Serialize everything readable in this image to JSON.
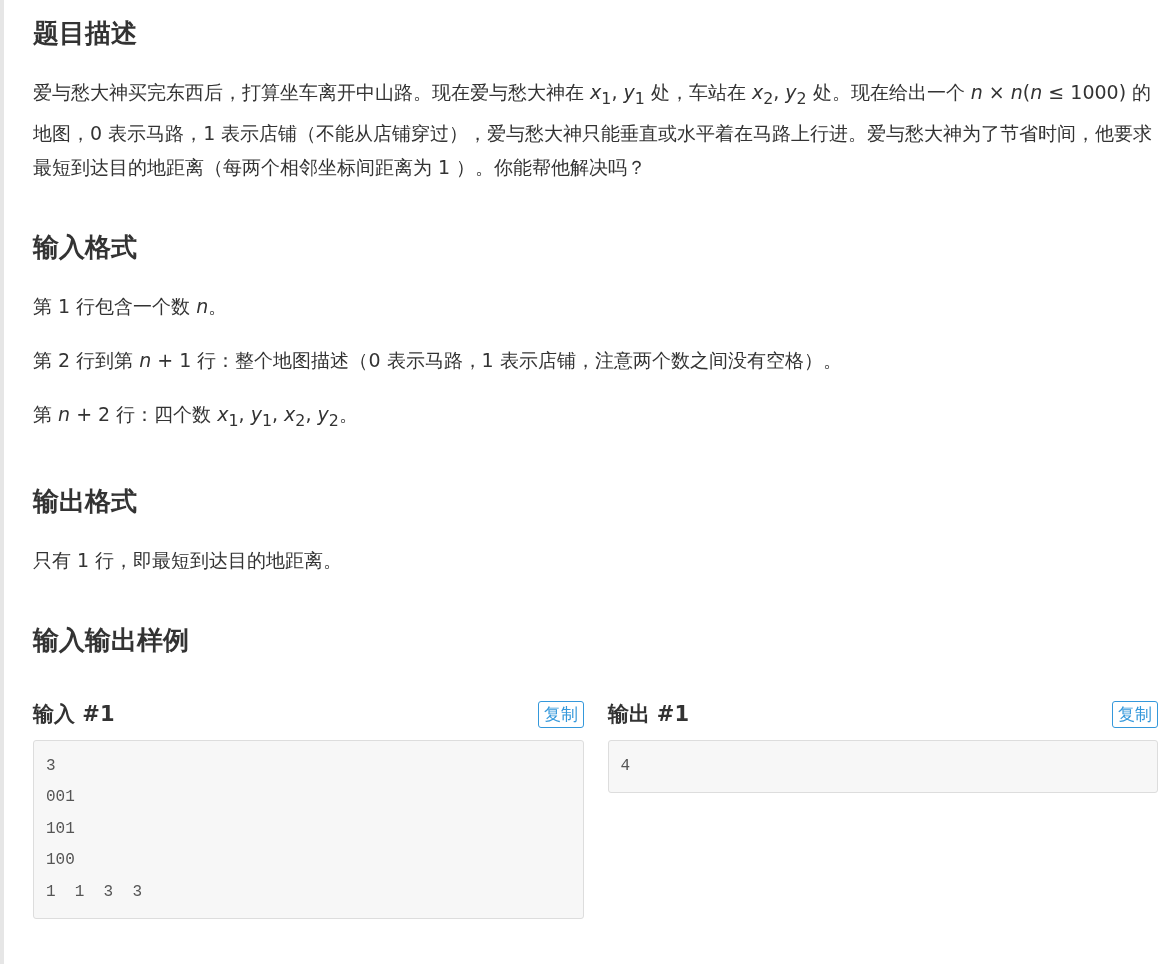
{
  "sections": [
    {
      "heading": "题目描述",
      "paragraphs": [
        "爱与愁大神买完东西后，打算坐车离开中山路。现在爱与愁大神在 *x*$_{1}$, *y*$_{1}$ 处，车站在 *x*$_{2}$, *y*$_{2}$ 处。现在给出一个 *n* × *n*(*n* ≤ 1000) 的地图，0 表示马路，1 表示店铺（不能从店铺穿过），爱与愁大神只能垂直或水平着在马路上行进。爱与愁大神为了节省时间，他要求最短到达目的地距离（每两个相邻坐标间距离为 1 ）。你能帮他解决吗？"
      ]
    },
    {
      "heading": "输入格式",
      "paragraphs": [
        "第 1 行包含一个数 *n*。",
        "第 2 行到第 *n* + 1 行：整个地图描述（0 表示马路，1 表示店铺，注意两个数之间没有空格）。",
        "第 *n* + 2 行：四个数 *x*$_{1}$, *y*$_{1}$, *x*$_{2}$, *y*$_{2}$。"
      ]
    },
    {
      "heading": "输出格式",
      "paragraphs": [
        "只有 1 行，即最短到达目的地距离。"
      ]
    },
    {
      "heading": "输入输出样例"
    }
  ],
  "samples": [
    {
      "label": "输入 #1",
      "copy": "复制",
      "lines": [
        "3",
        "001",
        "101",
        "100",
        "1  1  3  3"
      ]
    },
    {
      "label": "输出 #1",
      "copy": "复制",
      "lines": [
        "4"
      ]
    }
  ]
}
